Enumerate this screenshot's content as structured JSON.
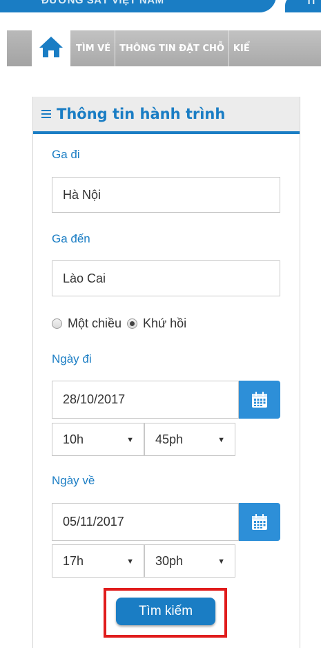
{
  "header": {
    "site_name": "ĐƯỜNG SẮT VIỆT NAM",
    "right_tab": "TI"
  },
  "nav": {
    "items": [
      {
        "label": "TÌM VÉ"
      },
      {
        "label": "THÔNG TIN ĐẶT CHỖ"
      },
      {
        "label": "KIỂ"
      }
    ]
  },
  "panel": {
    "title": "Thông tin hành trình",
    "departure_station": {
      "label": "Ga đi",
      "value": "Hà Nội"
    },
    "arrival_station": {
      "label": "Ga đến",
      "value": "Lào Cai"
    },
    "trip_type": {
      "options": [
        "Một chiều",
        "Khứ hồi"
      ],
      "selected": "Khứ hồi"
    },
    "departure": {
      "label": "Ngày đi",
      "date": "28/10/2017",
      "hour": "10h",
      "minute": "45ph"
    },
    "return": {
      "label": "Ngày về",
      "date": "05/11/2017",
      "hour": "17h",
      "minute": "30ph"
    },
    "search_label": "Tìm kiếm"
  },
  "colors": {
    "brand_blue": "#1a7dc4",
    "highlight_red": "#e01c1c",
    "nav_grey": "#b3b3b3"
  },
  "icons": {
    "home": "home-icon",
    "menu": "menu-icon",
    "calendar": "calendar-icon",
    "dropdown": "caret-down-icon"
  }
}
